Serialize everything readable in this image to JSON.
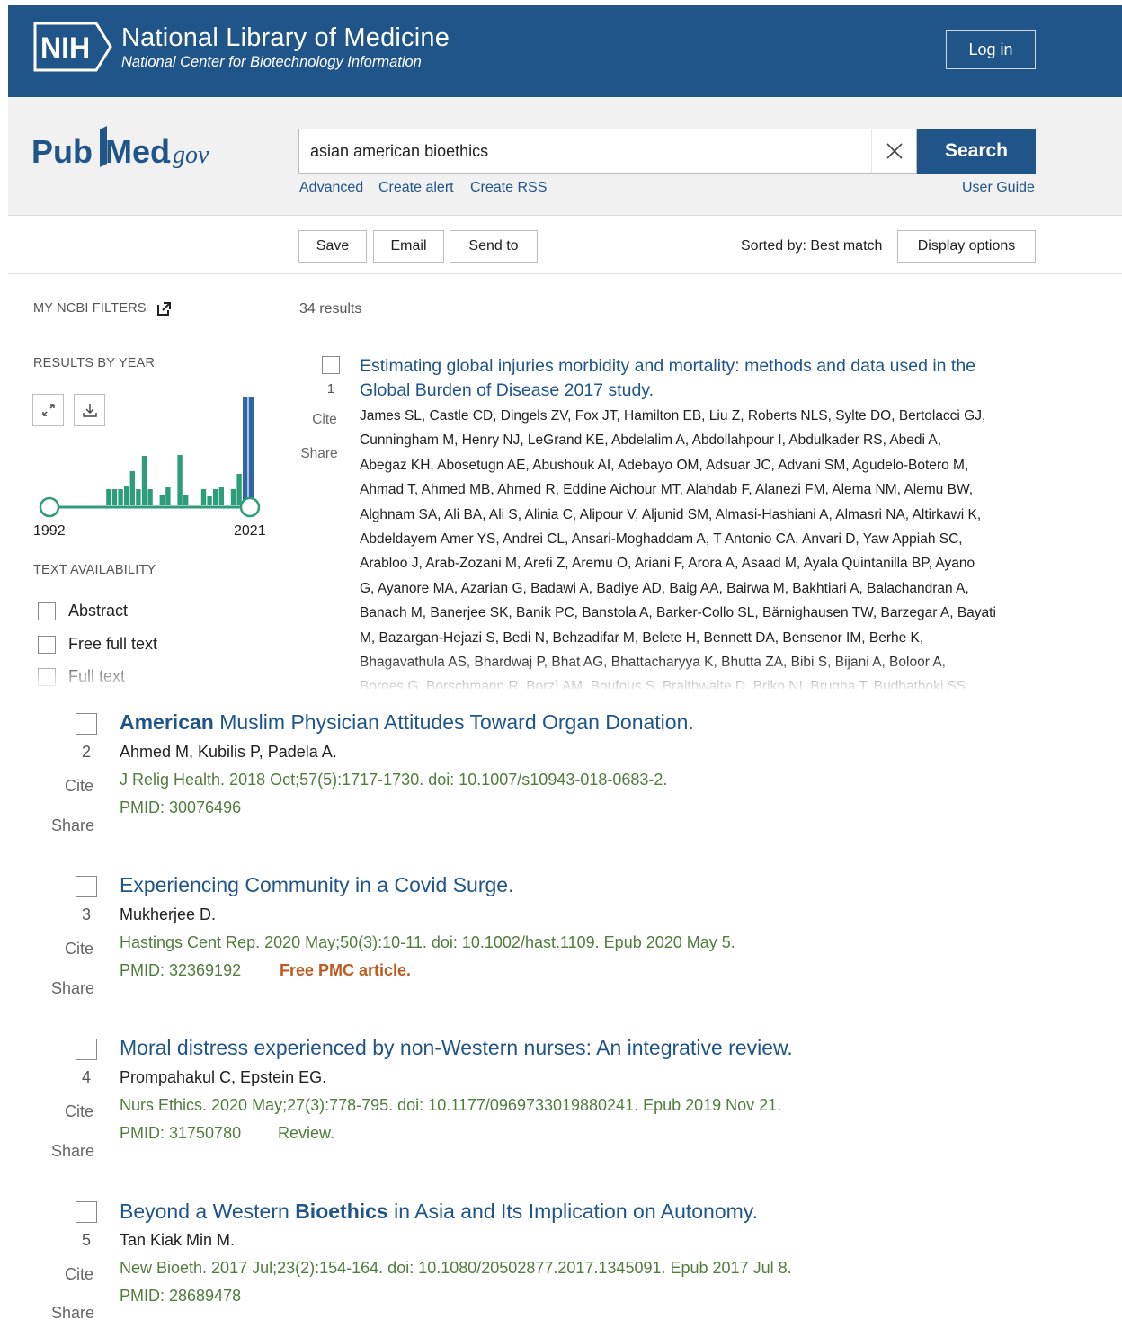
{
  "header": {
    "logo_text": "NIH",
    "title": "National Library of Medicine",
    "subtitle": "National Center for Biotechnology Information",
    "login_label": "Log in"
  },
  "search": {
    "logo_text_pub": "Pub",
    "logo_text_med": "Med",
    "logo_text_gov": ".gov",
    "query": "asian american bioethics",
    "button_label": "Search",
    "links": {
      "advanced": "Advanced",
      "create_alert": "Create alert",
      "create_rss": "Create RSS",
      "user_guide": "User Guide"
    }
  },
  "toolbar": {
    "save": "Save",
    "email": "Email",
    "send_to": "Send to",
    "sorted_by": "Sorted by: Best match",
    "display_options": "Display options"
  },
  "sidebar": {
    "my_filters": "MY NCBI FILTERS",
    "results_by_year": "RESULTS BY YEAR",
    "year_start": "1992",
    "year_end": "2021",
    "text_availability": "TEXT AVAILABILITY",
    "filters": [
      "Abstract",
      "Free full text",
      "Full text"
    ]
  },
  "results_count": "34 results",
  "actions": {
    "cite": "Cite",
    "share": "Share"
  },
  "results": [
    {
      "num": "1",
      "title_lines": [
        "Estimating global injuries morbidity and mortality: methods and data used in the",
        "Global Burden of Disease 2017 study."
      ],
      "author_lines": [
        "James SL, Castle CD, Dingels ZV, Fox JT, Hamilton EB, Liu Z, Roberts NLS, Sylte DO, Bertolacci GJ,",
        "Cunningham M, Henry NJ, LeGrand KE, Abdelalim A, Abdollahpour I, Abdulkader RS, Abedi A,",
        "Abegaz KH, Abosetugn AE, Abushouk AI, Adebayo OM, Adsuar JC, Advani SM, Agudelo-Botero M,",
        "Ahmad T, Ahmed MB, Ahmed R, Eddine Aichour MT, Alahdab F, Alanezi FM, Alema NM, Alemu BW,",
        "Alghnam SA, Ali BA, Ali S, Alinia C, Alipour V, Aljunid SM, Almasi-Hashiani A, Almasri NA, Altirkawi K,",
        "Abdeldayem Amer YS, Andrei CL, Ansari-Moghaddam A, T Antonio CA, Anvari D, Yaw Appiah SC,",
        "Arabloo J, Arab-Zozani M, Arefi Z, Aremu O, Ariani F, Arora A, Asaad M, Ayala Quintanilla BP, Ayano",
        "G, Ayanore MA, Azarian G, Badawi A, Badiye AD, Baig AA, Bairwa M, Bakhtiari A, Balachandran A,",
        "Banach M, Banerjee SK, Banik PC, Banstola A, Barker-Collo SL, Bärnighausen TW, Barzegar A, Bayati",
        "M, Bazargan-Hejazi S, Bedi N, Behzadifar M, Belete H, Bennett DA, Bensenor IM, Berhe K,",
        "Bhagavathula AS, Bhardwaj P, Bhat AG, Bhattacharyya K, Bhutta ZA, Bibi S, Bijani A, Boloor A,",
        "Borges G, Borschmann R, Borzì AM, Boufous S, Braithwaite D, Briko NI, Brugha T, Budhathoki SS,"
      ]
    },
    {
      "num": "2",
      "title_bold": "American",
      "title_rest": " Muslim Physician Attitudes Toward Organ Donation.",
      "authors": "Ahmed M, Kubilis P, Padela A.",
      "journal": "J Relig Health. 2018 Oct;57(5):1717-1730. doi: 10.1007/s10943-018-0683-2.",
      "pmid": "PMID: 30076496"
    },
    {
      "num": "3",
      "title": "Experiencing Community in a Covid Surge.",
      "authors": "Mukherjee D.",
      "journal": "Hastings Cent Rep. 2020 May;50(3):10-11. doi: 10.1002/hast.1109. Epub 2020 May 5.",
      "pmid": "PMID: 32369192",
      "free": "Free PMC article."
    },
    {
      "num": "4",
      "title": "Moral distress experienced by non-Western nurses: An integrative review.",
      "authors": "Prompahakul C, Epstein EG.",
      "journal": "Nurs Ethics. 2020 May;27(3):778-795. doi: 10.1177/0969733019880241. Epub 2019 Nov 21.",
      "pmid": "PMID: 31750780",
      "tag": "Review."
    },
    {
      "num": "5",
      "title_a": "Beyond a Western ",
      "title_bold": "Bioethics",
      "title_b": " in Asia and Its Implication on Autonomy.",
      "authors": "Tan Kiak Min M.",
      "journal": "New Bioeth. 2017 Jul;23(2):154-164. doi: 10.1080/20502877.2017.1345091. Epub 2017 Jul 8.",
      "pmid": "PMID: 28689478"
    }
  ],
  "colors": {
    "header_bg": "#20558a",
    "link": "#20558a",
    "journal_green": "#4f7d3c",
    "free_orange": "#bf5a1f",
    "chart_green": "#2e9e7a",
    "chart_blue": "#2f66a3"
  },
  "icons": [
    "nih-logo-icon",
    "external-link-icon",
    "expand-icon",
    "download-icon",
    "close-icon"
  ]
}
